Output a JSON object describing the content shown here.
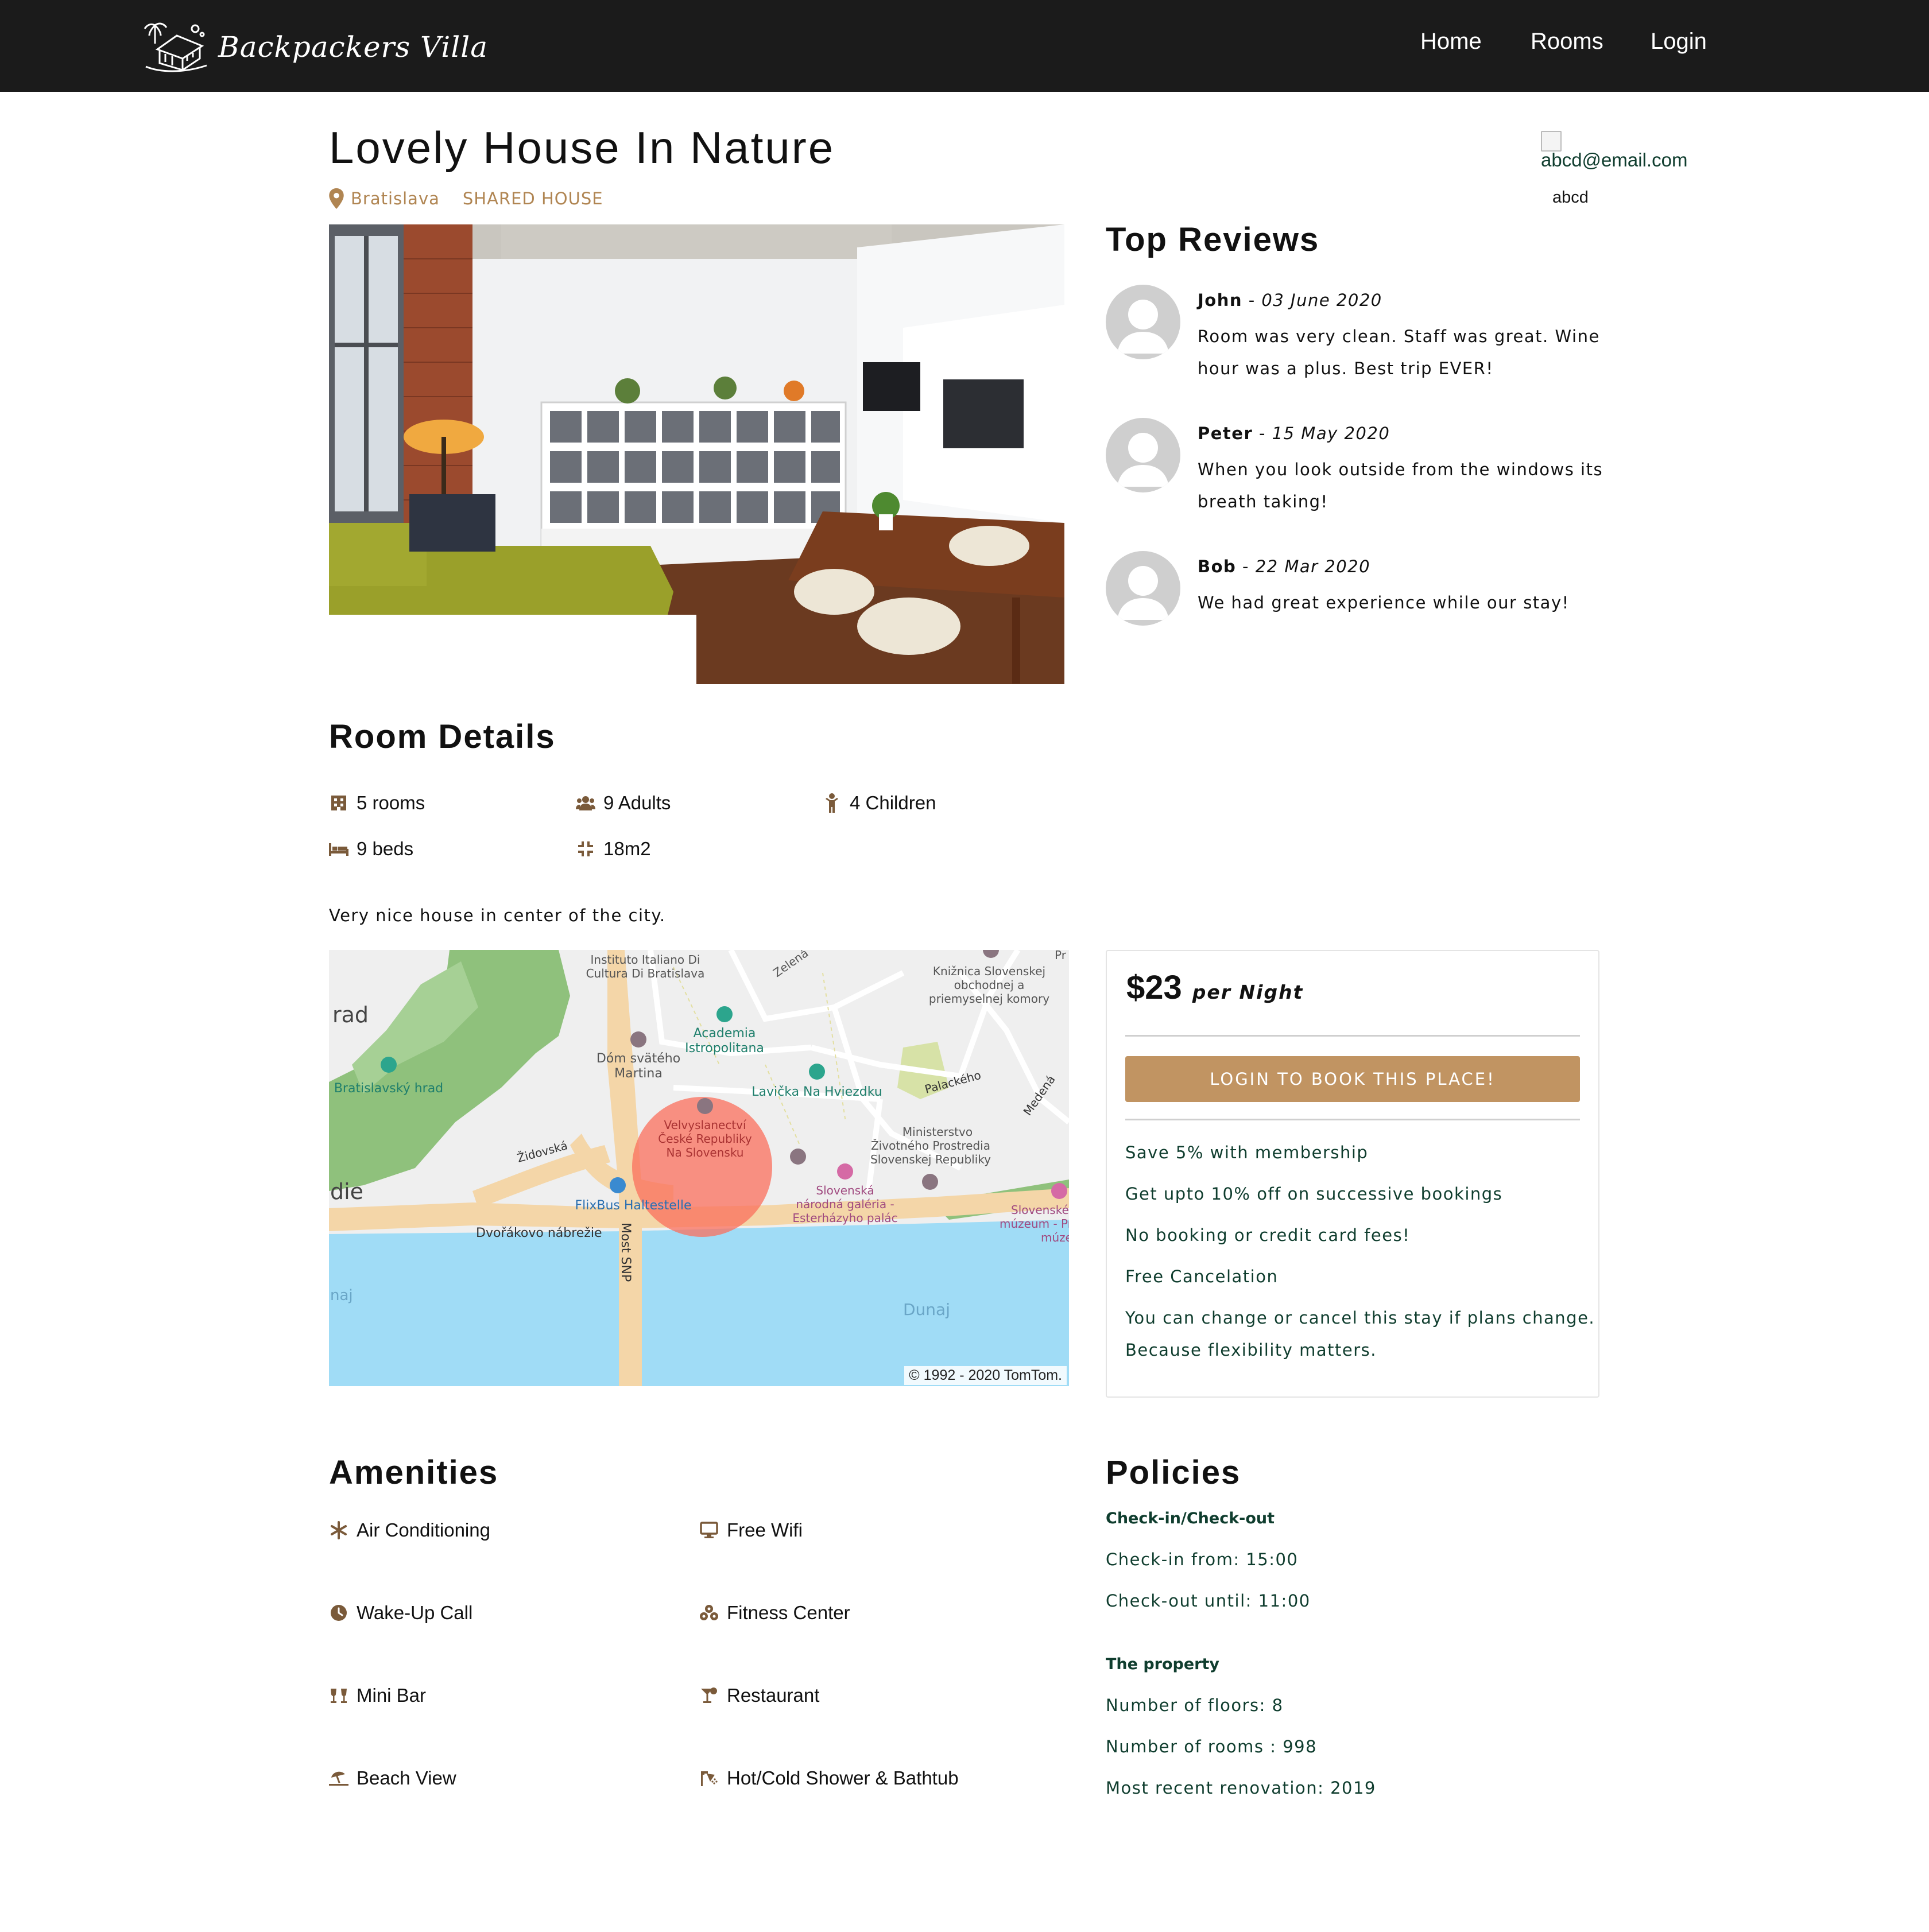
{
  "navbar": {
    "brand": "Backpackers Villa",
    "links": [
      "Home",
      "Rooms",
      "Login"
    ]
  },
  "listing": {
    "title": "Lovely House In Nature",
    "city": "Bratislava",
    "category": "SHARED HOUSE"
  },
  "user": {
    "email": "abcd@email.com",
    "name": "abcd"
  },
  "reviews": {
    "heading": "Top Reviews",
    "items": [
      {
        "name": "John",
        "separator": " - ",
        "date": "03 June 2020",
        "text": "Room was very clean. Staff was great. Wine hour was a plus. Best trip EVER!"
      },
      {
        "name": "Peter",
        "separator": " - ",
        "date": "15 May 2020",
        "text": "When you look outside from the windows its breath taking!"
      },
      {
        "name": "Bob",
        "separator": " - ",
        "date": "22 Mar 2020",
        "text": "We had great experience while our stay!"
      }
    ]
  },
  "room_details": {
    "heading": "Room Details",
    "items": [
      {
        "icon": "building-icon",
        "label": "5 rooms"
      },
      {
        "icon": "users-icon",
        "label": "9 Adults"
      },
      {
        "icon": "child-icon",
        "label": "4 Children"
      },
      {
        "icon": "bed-icon",
        "label": "9 beds"
      },
      {
        "icon": "compress-icon",
        "label": "18m2"
      }
    ],
    "description": "Very nice house in center of the city."
  },
  "map": {
    "copyright": "© 1992 - 2020 TomTom.",
    "labels": {
      "instituto": [
        "Instituto Italiano Di",
        "Cultura Di Bratislava"
      ],
      "zelena": "Zelená",
      "kniznica": [
        "Knižnica Slovenskej",
        "obchodnej a",
        "priemyselnej komory"
      ],
      "pr": "Pr",
      "rad": "rad",
      "academia": [
        "Academia",
        "Istropolitana"
      ],
      "dom": [
        "Dóm svätého",
        "Martina"
      ],
      "hrad": "Bratislavský hrad",
      "lavicka": "Lavička Na Hviezdku",
      "palackeho": "Palackého",
      "medena": "Medená",
      "velvyslanectvi": [
        "Velvyslanectví",
        "České Republiky",
        "Na Slovensku"
      ],
      "zidovska": "Židovská",
      "ministerstvo": [
        "Ministerstvo",
        "Životného Prostredia",
        "Slovenskej Republiky"
      ],
      "die": "die",
      "flixbus": "FlixBus Haltestelle",
      "galeria": [
        "Slovenská",
        "národná galéria -",
        "Esterházyho palác"
      ],
      "slovenske": [
        "Slovenské",
        "múzeum - Pri",
        "múze"
      ],
      "dvorakovo": "Dvořákovo nábrežie",
      "most": "Most SNP",
      "naj": "naj",
      "dunaj": "Dunaj"
    }
  },
  "booking": {
    "price": "$23",
    "per": "per Night",
    "button": "LOGIN TO BOOK THIS PLACE!",
    "perks": [
      "Save 5% with membership",
      "Get upto 10% off on successive bookings",
      "No booking or credit card fees!",
      "Free Cancelation",
      "You can change or cancel this stay if plans change.",
      "Because flexibility matters."
    ]
  },
  "amenities": {
    "heading": "Amenities",
    "items": [
      {
        "icon": "snowflake-icon",
        "label": "Air Conditioning"
      },
      {
        "icon": "desktop-icon",
        "label": "Free Wifi"
      },
      {
        "icon": "clock-icon",
        "label": "Wake-Up Call"
      },
      {
        "icon": "dumbbell-icon",
        "label": "Fitness Center"
      },
      {
        "icon": "glasses-icon",
        "label": "Mini Bar"
      },
      {
        "icon": "cocktail-icon",
        "label": "Restaurant"
      },
      {
        "icon": "umbrella-beach-icon",
        "label": "Beach View"
      },
      {
        "icon": "shower-icon",
        "label": "Hot/Cold Shower & Bathtub"
      }
    ]
  },
  "policies": {
    "heading": "Policies",
    "checkin_title": "Check-in/Check-out",
    "checkin_from": "Check-in from: 15:00",
    "checkout_until": "Check-out until: 11:00",
    "property_title": "The property",
    "floors": "Number of floors: 8",
    "rooms": "Number of rooms : 998",
    "renovation": "Most recent renovation: 2019"
  },
  "colors": {
    "navbar": "#1b1b1b",
    "accent": "#b08552",
    "button": "#c19462",
    "policy_text": "#0f3d2e"
  }
}
